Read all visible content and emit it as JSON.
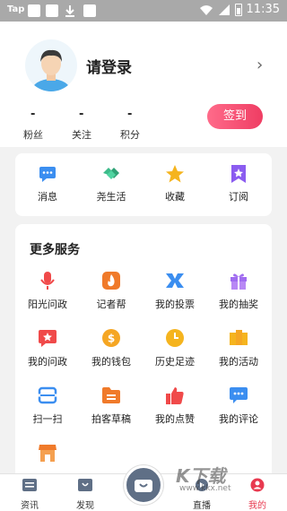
{
  "status_bar": {
    "app": "Tap",
    "time": "11:35"
  },
  "profile": {
    "login_label": "请登录",
    "stats": [
      {
        "value": "-",
        "label": "粉丝"
      },
      {
        "value": "-",
        "label": "关注"
      },
      {
        "value": "-",
        "label": "积分"
      }
    ],
    "sign_in_label": "签到"
  },
  "quick_actions": [
    {
      "label": "消息",
      "icon": "message-icon",
      "color": "#3b8ef0"
    },
    {
      "label": "尧生活",
      "icon": "handshake-icon",
      "color": "#3dbb8a"
    },
    {
      "label": "收藏",
      "icon": "star-icon",
      "color": "#f5b41e"
    },
    {
      "label": "订阅",
      "icon": "bookmark-icon",
      "color": "#8b5cf0"
    }
  ],
  "more_services": {
    "title": "更多服务",
    "items": [
      {
        "label": "阳光问政",
        "icon": "microphone-icon",
        "color": "#f04a4a"
      },
      {
        "label": "记者帮",
        "icon": "flame-icon",
        "color": "#f07a2a"
      },
      {
        "label": "我的投票",
        "icon": "vote-icon",
        "color": "#3b8ef0"
      },
      {
        "label": "我的抽奖",
        "icon": "gift-icon",
        "color": "#a06cf0"
      },
      {
        "label": "我的问政",
        "icon": "star-badge-icon",
        "color": "#f04a4a"
      },
      {
        "label": "我的钱包",
        "icon": "wallet-icon",
        "color": "#f5a623"
      },
      {
        "label": "历史足迹",
        "icon": "clock-icon",
        "color": "#f5b41e"
      },
      {
        "label": "我的活动",
        "icon": "flag-icon",
        "color": "#f5a623"
      },
      {
        "label": "扫一扫",
        "icon": "scan-icon",
        "color": "#3b8ef0"
      },
      {
        "label": "拍客草稿",
        "icon": "folder-icon",
        "color": "#f07a2a"
      },
      {
        "label": "我的点赞",
        "icon": "thumbs-up-icon",
        "color": "#f04a4a"
      },
      {
        "label": "我的评论",
        "icon": "comment-icon",
        "color": "#3b8ef0"
      }
    ]
  },
  "tab_bar": [
    {
      "label": "资讯",
      "icon": "news-icon"
    },
    {
      "label": "发现",
      "icon": "discover-icon"
    },
    {
      "label": "",
      "icon": "camera-icon"
    },
    {
      "label": "直播",
      "icon": "live-icon"
    },
    {
      "label": "我的",
      "icon": "profile-icon",
      "color": "#e8394f"
    }
  ],
  "watermark": {
    "brand": "K下载",
    "url": "www.kkx.net"
  }
}
